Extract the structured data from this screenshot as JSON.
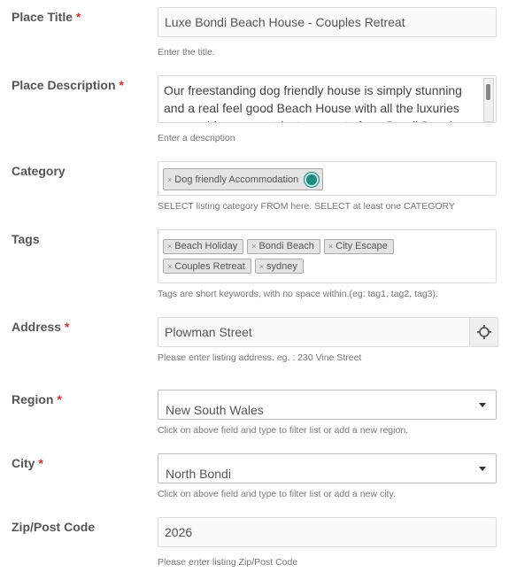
{
  "fields": {
    "title": {
      "label": "Place Title",
      "required_mark": "*",
      "value": "Luxe Bondi Beach House - Couples Retreat",
      "help": "Enter the title."
    },
    "description": {
      "label": "Place Description",
      "required_mark": "*",
      "value": "Our freestanding dog friendly house is simply stunning and a real feel good Beach House with all the luxuries you could ever want, just moments from Bondi Beach.",
      "help": "Enter a description"
    },
    "category": {
      "label": "Category",
      "chips": [
        "Dog friendly Accommodation"
      ],
      "help": "SELECT listing category FROM here. SELECT at least one CATEGORY"
    },
    "tags": {
      "label": "Tags",
      "chips": [
        "Beach Holiday",
        "Bondi Beach",
        "City Escape",
        "Couples Retreat",
        "sydney"
      ],
      "help": "Tags are short keywords, with no space within.(eg: tag1, tag2, tag3)."
    },
    "address": {
      "label": "Address",
      "required_mark": "*",
      "value": "Plowman Street",
      "help": "Please enter listing address. eg. : 230 Vine Street"
    },
    "region": {
      "label": "Region",
      "required_mark": "*",
      "value": "New South Wales",
      "help": "Click on above field and type to filter list or add a new region."
    },
    "city": {
      "label": "City",
      "required_mark": "*",
      "value": "North Bondi",
      "help": "Click on above field and type to filter list or add a new city."
    },
    "zip": {
      "label": "Zip/Post Code",
      "value": "2026",
      "help": "Please enter listing Zip/Post Code"
    }
  },
  "chip_remove_symbol": "×",
  "colors": {
    "required": "#d9302b",
    "toggle_dot": "#1f8a82"
  },
  "icons": {
    "address_locate": "crosshair-icon",
    "dropdown": "caret-down-icon",
    "chip_remove": "close-icon"
  }
}
